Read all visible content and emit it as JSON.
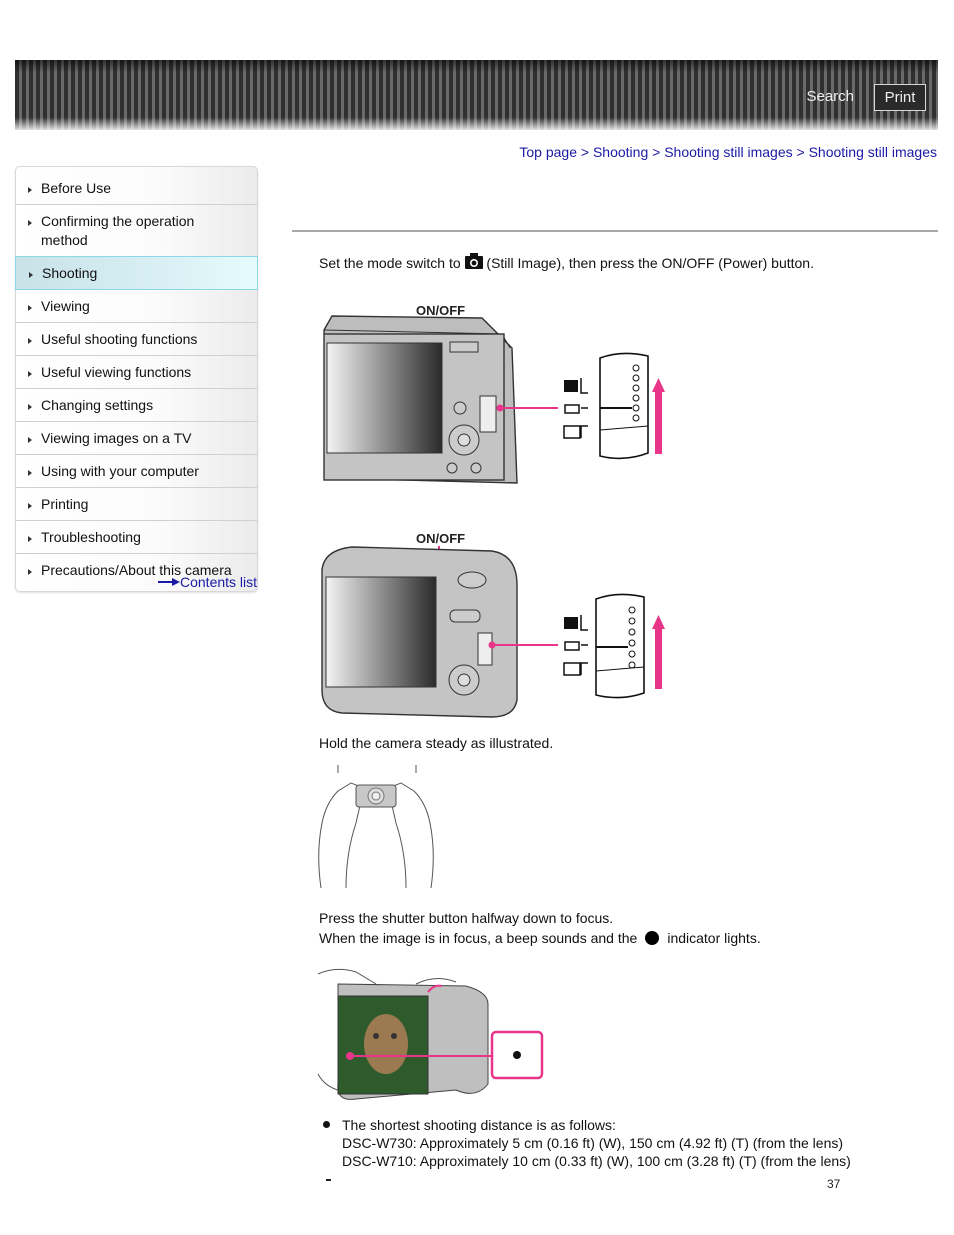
{
  "header": {
    "search_label": "Search",
    "print_label": "Print"
  },
  "breadcrumb": {
    "items": [
      "Top page",
      "Shooting",
      "Shooting still images",
      "Shooting still images"
    ],
    "separator": ">"
  },
  "sidebar": {
    "items": [
      {
        "label": "Before Use",
        "active": false
      },
      {
        "label": "Confirming the operation method",
        "active": false
      },
      {
        "label": "Shooting",
        "active": true
      },
      {
        "label": "Viewing",
        "active": false
      },
      {
        "label": "Useful shooting functions",
        "active": false
      },
      {
        "label": "Useful viewing functions",
        "active": false
      },
      {
        "label": "Changing settings",
        "active": false
      },
      {
        "label": "Viewing images on a TV",
        "active": false
      },
      {
        "label": "Using with your computer",
        "active": false
      },
      {
        "label": "Printing",
        "active": false
      },
      {
        "label": "Troubleshooting",
        "active": false
      },
      {
        "label": "Precautions/About this camera",
        "active": false
      }
    ],
    "contents_link": "Contents list"
  },
  "main": {
    "step1": {
      "before_icon": "Set the mode switch to",
      "icon": "still-image-camera-icon",
      "after_icon": "(Still Image), then press the ON/OFF (Power) button."
    },
    "figure1": {
      "callout": "ON/OFF",
      "model": "camera-model-a"
    },
    "figure2": {
      "callout": "ON/OFF",
      "model": "camera-model-b"
    },
    "step2": "Hold the camera steady as illustrated.",
    "step3_line1": "Press the shutter button halfway down to focus.",
    "step3_line2_before": "When the image is in focus, a beep sounds and the",
    "step3_line2_after": "indicator lights.",
    "note": {
      "lines": [
        "The shortest shooting distance is as follows:",
        "DSC-W730: Approximately 5 cm (0.16 ft) (W), 150 cm (4.92 ft) (T) (from the lens)",
        "DSC-W710: Approximately 10 cm (0.33 ft) (W), 100 cm (3.28 ft) (T) (from the lens)"
      ]
    },
    "page_number": "37"
  },
  "colors": {
    "link": "#1a1aa6",
    "accent_pink": "#e8358a",
    "active_nav_border": "#8fd6e8"
  }
}
